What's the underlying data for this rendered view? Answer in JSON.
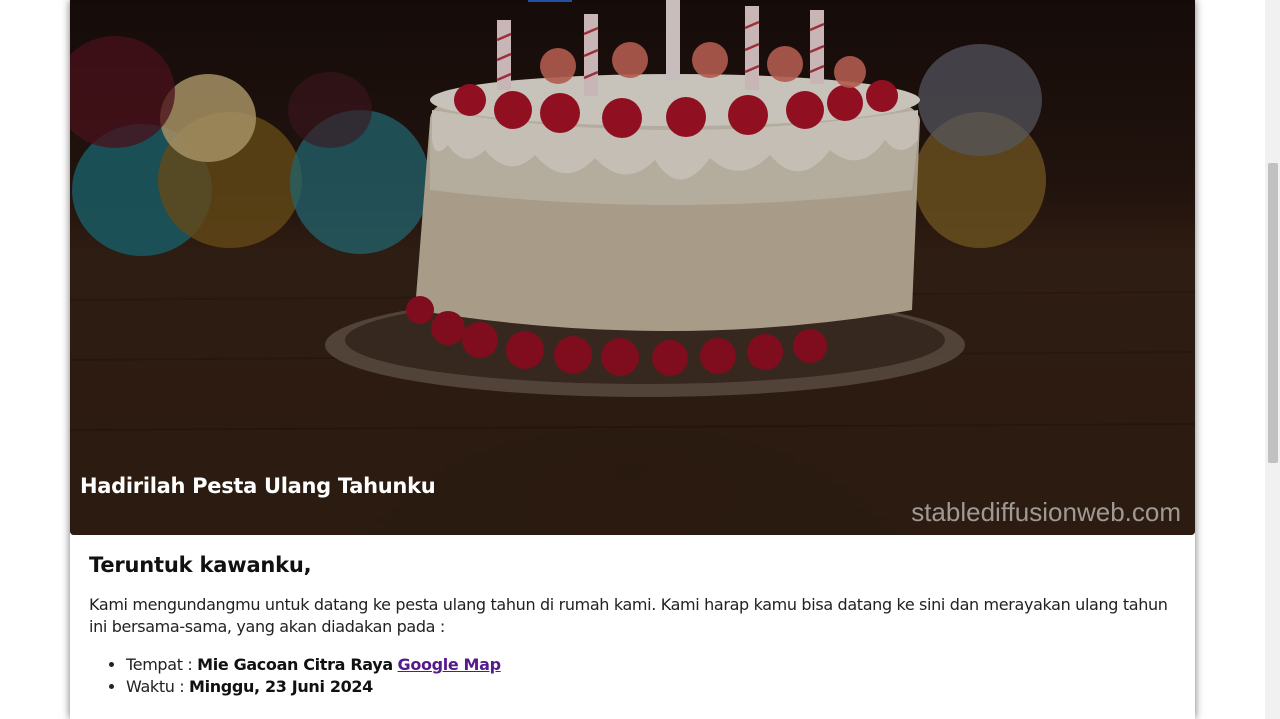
{
  "hero": {
    "title": "Hadirilah Pesta Ulang Tahunku",
    "watermark": "stablediffusionweb.com"
  },
  "invitation": {
    "greeting": "Teruntuk kawanku,",
    "intro": "Kami mengundangmu untuk datang ke pesta ulang tahun di rumah kami. Kami harap kamu bisa datang ke sini dan merayakan ulang tahun ini bersama-sama, yang akan diadakan pada :",
    "place_label": "Tempat : ",
    "place_value": "Mie Gacoan Citra Raya",
    "map_link": "Google Map",
    "time_label": "Waktu : ",
    "time_value": "Minggu, 23 Juni 2024"
  },
  "colors": {
    "link": "#551a8b",
    "text": "#222222",
    "hero_overlay": "#1a0f0c"
  }
}
